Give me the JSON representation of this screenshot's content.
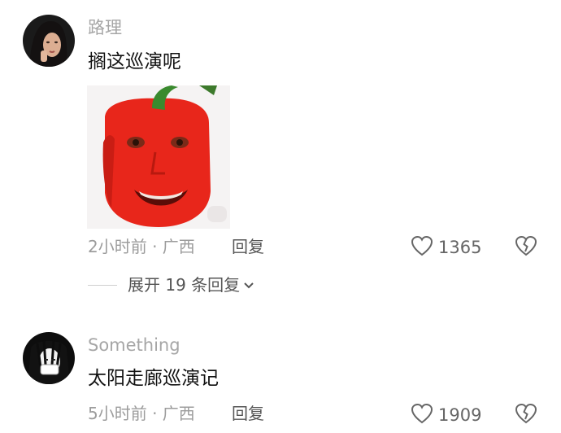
{
  "comments": [
    {
      "username": "路理",
      "text": "搁这巡演呢",
      "meta": "2小时前 · 广西",
      "reply_label": "回复",
      "likes": "1365",
      "has_sticker": true,
      "expand_label": "展开 19 条回复"
    },
    {
      "username": "Something",
      "text": "太阳走廊巡演记",
      "meta": "5小时前 · 广西",
      "reply_label": "回复",
      "likes": "1909"
    }
  ],
  "colors": {
    "username": "#a6a6a6",
    "text": "#111111",
    "meta": "#9c9c9c",
    "action": "#555555",
    "pepper_red": "#e8261b"
  },
  "icons": [
    "heart-outline-icon",
    "broken-heart-icon",
    "chevron-down-icon"
  ]
}
